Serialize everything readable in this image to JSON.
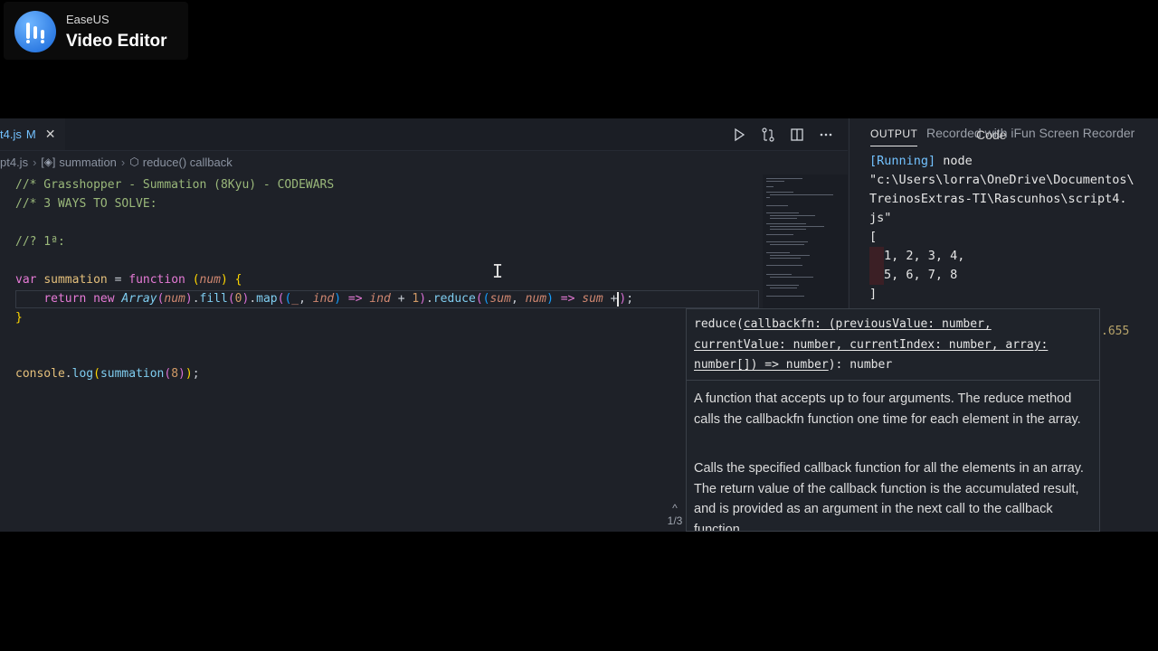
{
  "watermark": {
    "brand": "EaseUS",
    "product": "Video Editor",
    "logo_icon": "easeus-logo-icon"
  },
  "editor": {
    "tab": {
      "filename": "t4.js",
      "status": "M",
      "close": "✕"
    },
    "actions": [
      "run-icon",
      "compare-changes-icon",
      "split-editor-icon",
      "more-actions-icon"
    ],
    "breadcrumb": {
      "file": "pt4.js",
      "symbol1": "summation",
      "symbol2": "reduce() callback",
      "sep": "›"
    },
    "code": {
      "l1": "//* Grasshopper - Summation (8Kyu) - CODEWARS",
      "l2": "//* 3 WAYS TO SOLVE:",
      "l3": "//? 1ª:",
      "l4_var": "var",
      "l4_name": "summation",
      "l4_eq": " = ",
      "l4_fn": "function",
      "l4_param": "num",
      "l5_return": "return",
      "l5_new": "new",
      "l5_array": "Array",
      "l5_num": "num",
      "l5_fill": "fill",
      "l5_zero": "0",
      "l5_map": "map",
      "l5_us": "_",
      "l5_ind": "ind",
      "l5_arrow": "=>",
      "l5_ind2": "ind",
      "l5_plus": "+",
      "l5_one": "1",
      "l5_reduce": "reduce",
      "l5_sum": "sum",
      "l5_num2": "num",
      "l5_arrow2": "=>",
      "l5_sum2": "sum",
      "l5_plus2": "+",
      "l6": "}",
      "l7_console": "console",
      "l7_log": "log",
      "l7_call": "summation",
      "l7_arg": "8"
    }
  },
  "output": {
    "title": "OUTPUT",
    "overlay": "Recorded with iFun Screen Recorder",
    "select": "Code",
    "running": "[Running]",
    "cmd": "node",
    "path1": "\"c:\\Users\\lorra\\OneDrive\\Documentos\\",
    "path2": "TreinosExtras-TI\\Rascunhos\\script4.",
    "path3": "js\"",
    "open": "[",
    "row1": "1, 2, 3, 4,",
    "row2": "5, 6, 7, 8",
    "close": "]",
    "trail": ".655"
  },
  "hover": {
    "sig_name": "reduce(",
    "sig_p1": "callbackfn: (previousValue: number,",
    "sig_p2": "currentValue: number, currentIndex: number, array:",
    "sig_p3": "number[]) => number",
    "sig_ret": "): number",
    "para1": "A function that accepts up to four arguments. The reduce method calls the callbackfn function one time for each element in the array.",
    "para2": "Calls the specified callback function for all the elements in an array. The return value of the callback function is the accumulated result, and is provided as an argument in the next call to the callback function.",
    "nav_up": "^",
    "nav_count": "1/3"
  }
}
